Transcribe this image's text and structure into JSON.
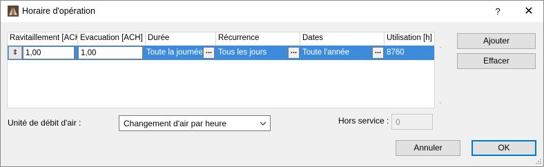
{
  "window": {
    "title": "Horaire d'opération",
    "help_label": "?",
    "close_label": "✕"
  },
  "grid": {
    "columns": [
      "Ravitaillement [ACH]",
      "Evacuation [ACH]",
      "Durée",
      "Récurrence",
      "Dates",
      "Utilisation [h]"
    ],
    "rows": [
      {
        "selector_glyph": "⇕",
        "ravitaillement": "1,00",
        "evacuation": "1,00",
        "duree": "Toute la journée",
        "recurrence": "Tous les jours",
        "dates": "Toute l'année",
        "utilisation": "8760"
      }
    ],
    "ellipsis": "...",
    "scroll_up": "⌃",
    "scroll_down": "⌄"
  },
  "buttons": {
    "add": "Ajouter",
    "delete": "Effacer",
    "cancel": "Annuler",
    "ok": "OK"
  },
  "airflow_unit": {
    "label": "Unité de débit d'air :",
    "selected": "Changement d'air par heure"
  },
  "out_of_service": {
    "label": "Hors service :",
    "value": "0"
  },
  "colors": {
    "selection": "#3d8cdb",
    "default_button_border": "#0078d7"
  }
}
